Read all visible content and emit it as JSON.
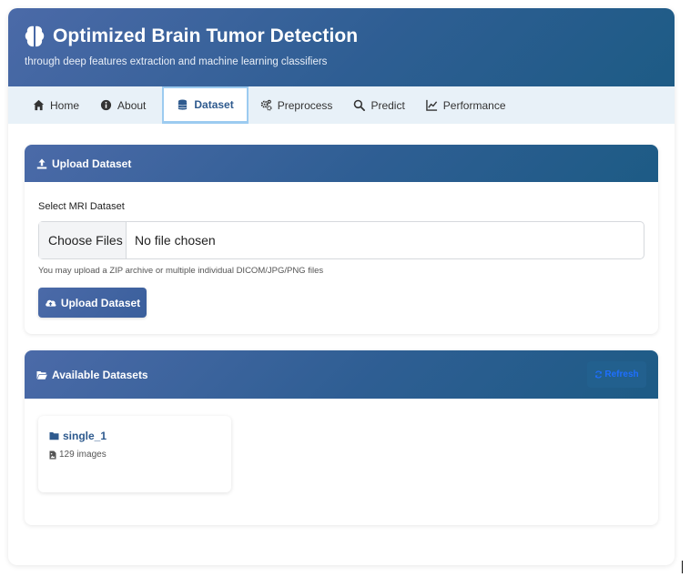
{
  "header": {
    "title": "Optimized Brain Tumor Detection",
    "subtitle": "through deep features extraction and machine learning classifiers",
    "logo_icon": "brain-icon"
  },
  "nav": {
    "tabs": [
      {
        "label": "Home",
        "icon": "home-icon",
        "active": false
      },
      {
        "label": "About",
        "icon": "info-icon",
        "active": false
      },
      {
        "label": "Dataset",
        "icon": "database-icon",
        "active": true
      },
      {
        "label": "Preprocess",
        "icon": "cogs-icon",
        "active": false
      },
      {
        "label": "Predict",
        "icon": "search-icon",
        "active": false
      },
      {
        "label": "Performance",
        "icon": "chart-line-icon",
        "active": false
      }
    ]
  },
  "upload": {
    "title": "Upload Dataset",
    "field_label": "Select MRI Dataset",
    "file_button": "Choose Files",
    "file_status": "No file chosen",
    "help_text": "You may upload a ZIP archive or multiple individual DICOM/JPG/PNG files",
    "submit_label": "Upload Dataset"
  },
  "datasets": {
    "title": "Available Datasets",
    "refresh_label": "Refresh",
    "items": [
      {
        "name": "single_1",
        "count": "129 images"
      }
    ]
  },
  "colors": {
    "header_gradient_start": "#4b6aa8",
    "header_gradient_end": "#1d5b85",
    "nav_bg": "#e8f1f8",
    "active_tab_text": "#2e5a8e",
    "active_tab_border": "#9ccbf0",
    "refresh_text": "#1e6fff"
  }
}
